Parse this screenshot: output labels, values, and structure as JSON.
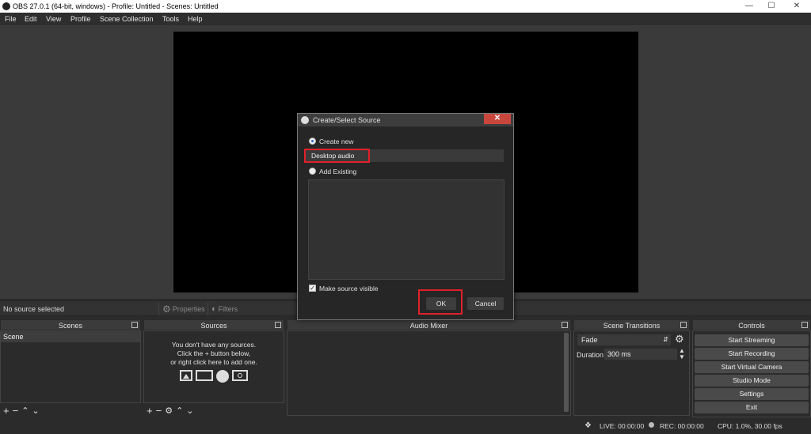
{
  "window": {
    "title": "OBS 27.0.1 (64-bit, windows) - Profile: Untitled - Scenes: Untitled",
    "minimize_glyph": "—",
    "maximize_glyph": "☐",
    "close_glyph": "✕"
  },
  "menu": [
    "File",
    "Edit",
    "View",
    "Profile",
    "Scene Collection",
    "Tools",
    "Help"
  ],
  "source_toolbar": {
    "status": "No source selected",
    "properties_label": "Properties",
    "filters_label": "Filters"
  },
  "docks": {
    "scenes": {
      "title": "Scenes",
      "items": [
        "Scene"
      ]
    },
    "sources": {
      "title": "Sources",
      "empty_line1": "You don't have any sources.",
      "empty_line2": "Click the + button below,",
      "empty_line3": "or right click here to add one."
    },
    "audio_mixer": {
      "title": "Audio Mixer"
    },
    "transitions": {
      "title": "Scene Transitions",
      "selected": "Fade",
      "duration_label": "Duration",
      "duration_value": "300 ms"
    },
    "controls": {
      "title": "Controls",
      "buttons": [
        "Start Streaming",
        "Start Recording",
        "Start Virtual Camera",
        "Studio Mode",
        "Settings",
        "Exit"
      ]
    }
  },
  "status_bar": {
    "live": "LIVE: 00:00:00",
    "rec": "REC: 00:00:00",
    "cpu": "CPU: 1.0%, 30.00 fps"
  },
  "dialog": {
    "title": "Create/Select Source",
    "close_glyph": "✕",
    "create_new_label": "Create new",
    "name_value": "Desktop audio",
    "add_existing_label": "Add Existing",
    "visible_label": "Make source visible",
    "visible_checked": true,
    "ok_label": "OK",
    "cancel_label": "Cancel"
  },
  "colors": {
    "highlight": "#e0202a",
    "background": "#2b2b2b",
    "canvas": "#000000"
  }
}
